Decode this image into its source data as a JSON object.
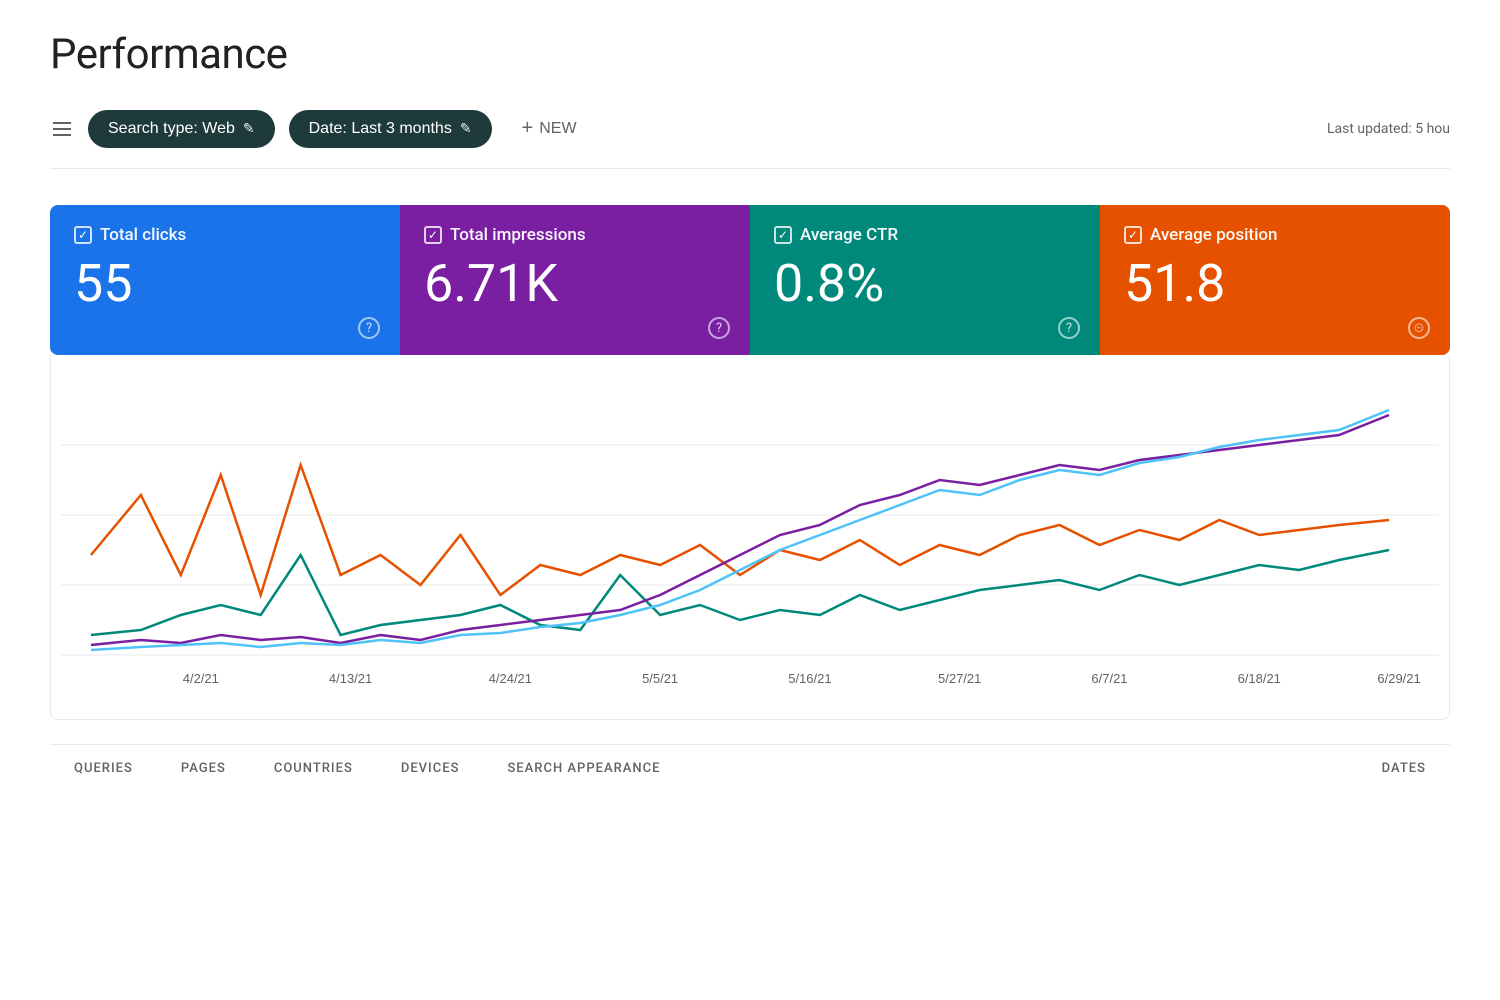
{
  "page": {
    "title": "Performance"
  },
  "toolbar": {
    "filter_icon": "≡",
    "search_type_btn": "Search type: Web",
    "date_btn": "Date: Last 3 months",
    "new_btn": "NEW",
    "last_updated": "Last updated: 5 hou"
  },
  "metrics": [
    {
      "id": "total-clicks",
      "label": "Total clicks",
      "value": "55",
      "color": "blue",
      "checked": true
    },
    {
      "id": "total-impressions",
      "label": "Total impressions",
      "value": "6.71K",
      "color": "purple",
      "checked": true
    },
    {
      "id": "average-ctr",
      "label": "Average CTR",
      "value": "0.8%",
      "color": "teal",
      "checked": true
    },
    {
      "id": "average-position",
      "label": "Average position",
      "value": "51.8",
      "color": "orange",
      "checked": true
    }
  ],
  "chart": {
    "x_labels": [
      "4/2/21",
      "4/13/21",
      "4/24/21",
      "5/5/21",
      "5/16/21",
      "5/27/21",
      "6/7/21",
      "6/18/21",
      "6/29/21"
    ],
    "series": {
      "blue": "#1a73e8",
      "purple": "#7b1fa2",
      "teal": "#00897b",
      "orange": "#e65100",
      "light_blue": "#4fc3f7"
    }
  },
  "tabs": {
    "right_tabs": [
      "DATES"
    ],
    "bottom_tabs": [
      "QUERIES",
      "PAGES",
      "COUNTRIES",
      "DEVICES",
      "SEARCH APPEARANCE",
      "DATES"
    ]
  }
}
